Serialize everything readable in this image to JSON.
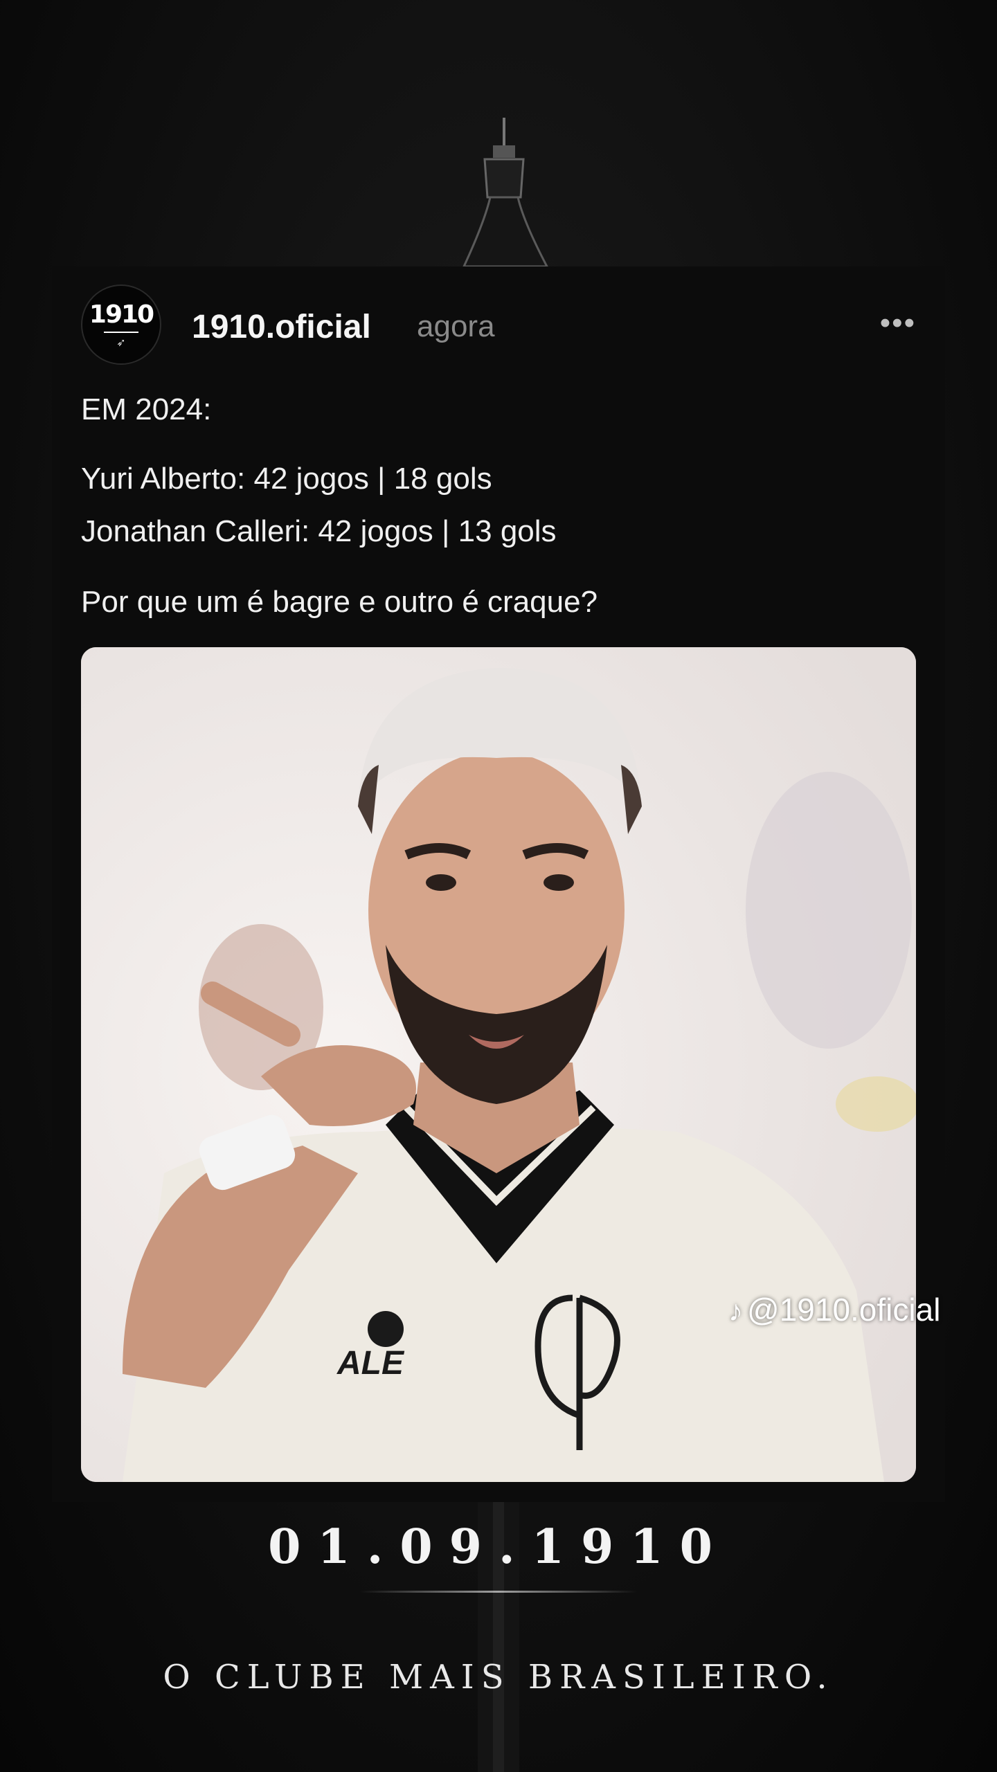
{
  "post": {
    "avatar_text": "1910",
    "username": "1910.oficial",
    "time": "agora",
    "more_label": "•••",
    "lines": [
      "EM 2024:",
      "Yuri Alberto: 42 jogos | 18 gols",
      "Jonathan Calleri: 42 jogos | 13 gols",
      "Por que um é bagre e outro é craque?"
    ],
    "photo_subject": "football player pointing at camera",
    "watermark": "@1910.oficial",
    "watermark_icon": "tiktok-icon"
  },
  "footer": {
    "date": "01.09.1910",
    "slogan": "O CLUBE MAIS BRASILEIRO."
  },
  "colors": {
    "background": "#101010",
    "card": "#0c0c0c",
    "text": "#f0f0f0",
    "muted": "#8a8a8a",
    "jersey": "#eeeae2"
  }
}
